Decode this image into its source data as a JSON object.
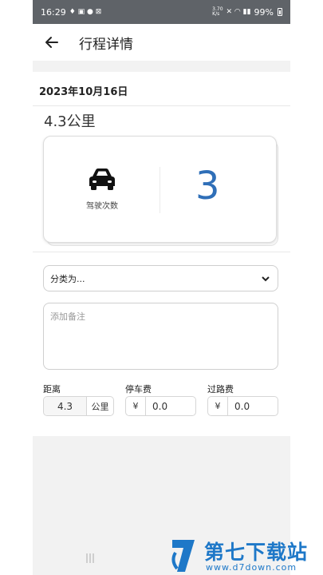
{
  "status_bar": {
    "time": "16:29",
    "net_speed_top": "3.70",
    "net_speed_bottom": "K/s",
    "battery": "99%"
  },
  "header": {
    "title": "行程详情"
  },
  "trip": {
    "date": "2023年10月16日",
    "distance_title": "4.3公里",
    "trips_label": "驾驶次数",
    "trips_count": "3"
  },
  "form": {
    "category_placeholder": "分类为...",
    "notes_placeholder": "添加备注",
    "distance_label": "距离",
    "distance_value": "4.3",
    "distance_unit": "公里",
    "parking_label": "停车费",
    "parking_currency": "¥",
    "parking_value": "0.0",
    "toll_label": "过路费",
    "toll_currency": "¥",
    "toll_value": "0.0"
  },
  "watermark": {
    "title": "第七下载站",
    "url": "www.d7down.com"
  },
  "colors": {
    "accent": "#2f6fb8",
    "status_bar": "#5f6368",
    "watermark": "#1e78c8"
  }
}
